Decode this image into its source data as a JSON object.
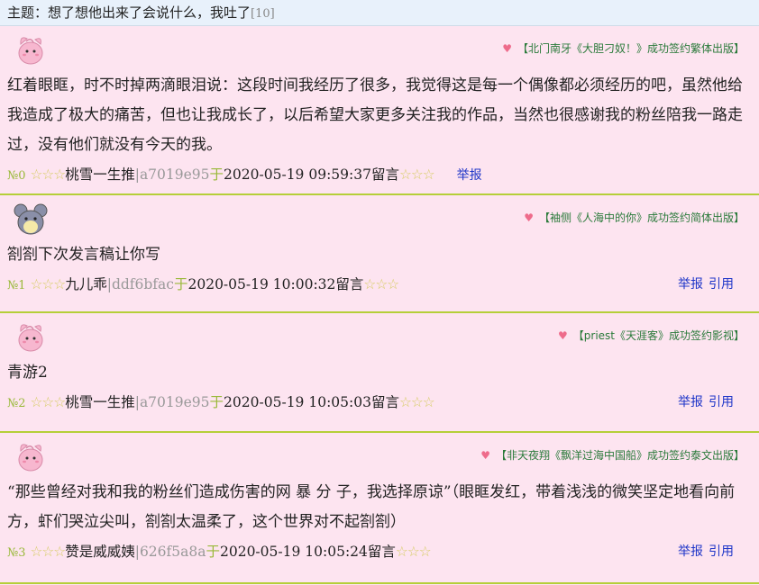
{
  "thread": {
    "prefix": "主题：",
    "title": "想了想他出来了会说什么，我吐了",
    "count": "[10]"
  },
  "posts": [
    {
      "ad": "【北门南牙《大胆刁奴！》成功签约繁体出版】",
      "content": "红着眼眶，时不时掉两滴眼泪说：这段时间我经历了很多，我觉得这是每一个偶像都必须经历的吧，虽然他给我造成了极大的痛苦，但也让我成长了，以后希望大家更多关注我的作品，当然也很感谢我的粉丝陪我一路走过，没有他们就没有今天的我。",
      "floor": "№0",
      "stars_left": "☆☆☆",
      "user": "桃雪一生推",
      "hash": "|a7019e95",
      "yu": "于",
      "time": "2020-05-19 09:59:37",
      "liuyan": "留言",
      "stars_right": "☆☆☆",
      "report": "举报",
      "quote": ""
    },
    {
      "ad": "【袖侧《人海中的你》成功签约简体出版】",
      "content": "劄劄下次发言稿让你写",
      "floor": "№1",
      "stars_left": "☆☆☆",
      "user": "九儿乖",
      "hash": "|ddf6bfac",
      "yu": "于",
      "time": "2020-05-19 10:00:32",
      "liuyan": "留言",
      "stars_right": "☆☆☆",
      "report": "举报",
      "quote": "引用"
    },
    {
      "ad": "【priest《天涯客》成功签约影视】",
      "content": "青游2",
      "floor": "№2",
      "stars_left": "☆☆☆",
      "user": "桃雪一生推",
      "hash": "|a7019e95",
      "yu": "于",
      "time": "2020-05-19 10:05:03",
      "liuyan": "留言",
      "stars_right": "☆☆☆",
      "report": "举报",
      "quote": "引用"
    },
    {
      "ad": "【非天夜翔《飘洋过海中国船》成功签约泰文出版】",
      "content": "“那些曾经对我和我的粉丝们造成伤害的网 暴 分 子，我选择原谅”（眼眶发红，带着浅浅的微笑坚定地看向前方，虾们哭泣尖叫，劄劄太温柔了，这个世界对不起劄劄）",
      "floor": "№3",
      "stars_left": "☆☆☆",
      "user": "赞是威威姨",
      "hash": "|626f5a8a",
      "yu": "于",
      "time": "2020-05-19 10:05:24",
      "liuyan": "留言",
      "stars_right": "☆☆☆",
      "report": "举报",
      "quote": "引用"
    }
  ]
}
